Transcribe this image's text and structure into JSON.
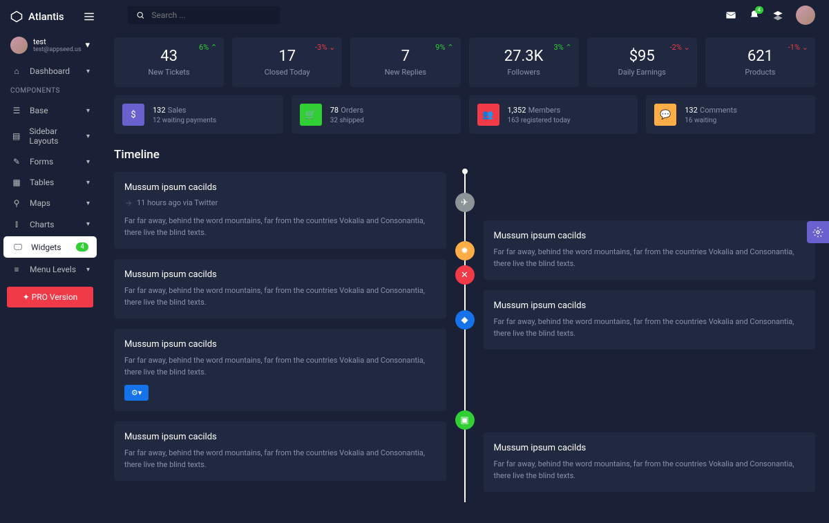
{
  "brand": "Atlantis",
  "user": {
    "name": "test",
    "email": "test@appseed.us"
  },
  "search": {
    "placeholder": "Search ..."
  },
  "nav": {
    "dashboard": "Dashboard",
    "section": "COMPONENTS",
    "items": [
      "Base",
      "Sidebar Layouts",
      "Forms",
      "Tables",
      "Maps",
      "Charts",
      "Widgets",
      "Menu Levels"
    ],
    "widgets_badge": "4",
    "pro": "PRO Version"
  },
  "topbar": {
    "notif_count": "4"
  },
  "stats": [
    {
      "val": "43",
      "lbl": "New Tickets",
      "pct": "6%",
      "dir": "up"
    },
    {
      "val": "17",
      "lbl": "Closed Today",
      "pct": "-3%",
      "dir": "down"
    },
    {
      "val": "7",
      "lbl": "New Replies",
      "pct": "9%",
      "dir": "up"
    },
    {
      "val": "27.3K",
      "lbl": "Followers",
      "pct": "3%",
      "dir": "up"
    },
    {
      "val": "$95",
      "lbl": "Daily Earnings",
      "pct": "-2%",
      "dir": "down"
    },
    {
      "val": "621",
      "lbl": "Products",
      "pct": "-1%",
      "dir": "down"
    }
  ],
  "info": [
    {
      "num": "132",
      "cat": "Sales",
      "sub": "12 waiting payments"
    },
    {
      "num": "78",
      "cat": "Orders",
      "sub": "32 shipped"
    },
    {
      "num": "1,352",
      "cat": "Members",
      "sub": "163 registered today"
    },
    {
      "num": "132",
      "cat": "Comments",
      "sub": "16 waiting"
    }
  ],
  "timeline": {
    "title": "Timeline",
    "left": [
      {
        "t": "Mussum ipsum cacilds",
        "meta": "11 hours ago via Twitter",
        "d": "Far far away, behind the word mountains, far from the countries Vokalia and Consonantia, there live the blind texts."
      },
      {
        "t": "Mussum ipsum cacilds",
        "d": "Far far away, behind the word mountains, far from the countries Vokalia and Consonantia, there live the blind texts."
      },
      {
        "t": "Mussum ipsum cacilds",
        "d": "Far far away, behind the word mountains, far from the countries Vokalia and Consonantia, there live the blind texts.",
        "gear": true
      },
      {
        "t": "Mussum ipsum cacilds",
        "d": "Far far away, behind the word mountains, far from the countries Vokalia and Consonantia, there live the blind texts."
      }
    ],
    "right": [
      {
        "t": "Mussum ipsum cacilds",
        "d": "Far far away, behind the word mountains, far from the countries Vokalia and Consonantia, there live the blind texts."
      },
      {
        "t": "Mussum ipsum cacilds",
        "d": "Far far away, behind the word mountains, far from the countries Vokalia and Consonantia, there live the blind texts."
      },
      {
        "t": "Mussum ipsum cacilds",
        "d": "Far far away, behind the word mountains, far from the countries Vokalia and Consonantia, there live the blind texts."
      }
    ]
  }
}
